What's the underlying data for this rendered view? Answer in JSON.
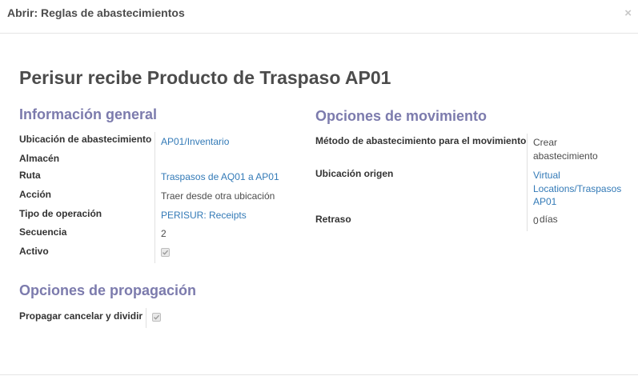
{
  "dialog": {
    "title": "Abrir: Reglas de abastecimientos",
    "close_symbol": "×"
  },
  "record": {
    "name": "Perisur recibe Producto de Traspaso AP01"
  },
  "general": {
    "title": "Información general",
    "fields": {
      "supply_location": {
        "label": "Ubicación de abastecimiento",
        "value": "AP01/Inventario"
      },
      "warehouse": {
        "label": "Almacén",
        "value": ""
      },
      "route": {
        "label": "Ruta",
        "value": "Traspasos de AQ01 a AP01"
      },
      "action": {
        "label": "Acción",
        "value": "Traer desde otra ubicación"
      },
      "operation_type": {
        "label": "Tipo de operación",
        "value": "PERISUR: Receipts"
      },
      "sequence": {
        "label": "Secuencia",
        "value": "2"
      },
      "active": {
        "label": "Activo",
        "checked": true
      }
    }
  },
  "propagation": {
    "title": "Opciones de propagación",
    "fields": {
      "propagate": {
        "label": "Propagar cancelar y dividir",
        "checked": true
      }
    }
  },
  "movement": {
    "title": "Opciones de movimiento",
    "fields": {
      "procure_method": {
        "label": "Método de abastecimiento para el movimiento",
        "value_line1": "Crear",
        "value_line2": "abastecimiento"
      },
      "source_location": {
        "label": "Ubicación origen",
        "value_line1": "Virtual",
        "value_line2": "Locations/Traspasos",
        "value_line3": "AP01"
      },
      "delay": {
        "label": "Retraso",
        "value": "0",
        "unit": "días"
      }
    }
  }
}
